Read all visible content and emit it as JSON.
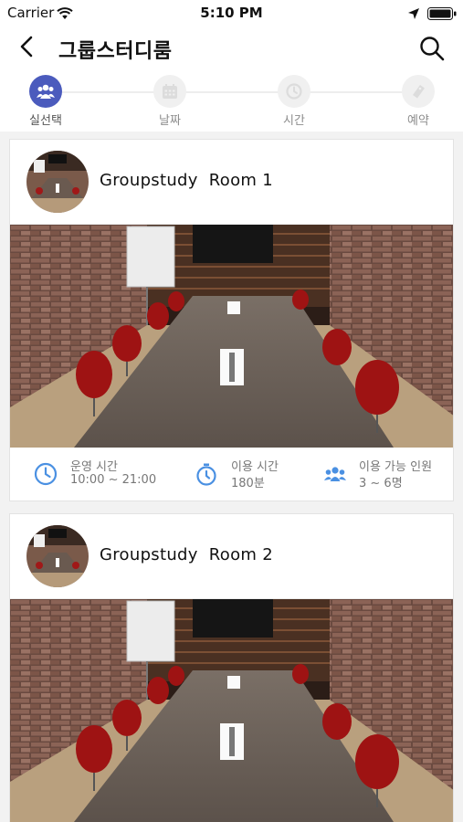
{
  "status_bar": {
    "carrier": "Carrier",
    "time": "5:10 PM"
  },
  "header": {
    "title": "그룹스터디룸"
  },
  "stepper": {
    "steps": [
      {
        "label": "실선택",
        "icon": "group-icon",
        "active": true
      },
      {
        "label": "날짜",
        "icon": "calendar-icon",
        "active": false
      },
      {
        "label": "시간",
        "icon": "clock-icon",
        "active": false
      },
      {
        "label": "예약",
        "icon": "ticket-icon",
        "active": false
      }
    ]
  },
  "rooms": [
    {
      "name": "Groupstudy  Room 1",
      "info": [
        {
          "label": "운영 시간",
          "value": "10:00 ~ 21:00",
          "icon": "clock-icon"
        },
        {
          "label": "이용 시간",
          "value": "180분",
          "icon": "stopwatch-icon"
        },
        {
          "label": "이용 가능 인원",
          "value": "3 ~ 6명",
          "icon": "people-icon"
        }
      ]
    },
    {
      "name": "Groupstudy  Room 2",
      "info": []
    }
  ],
  "colors": {
    "accent": "#4b5bbd",
    "info_icon": "#4a90e2"
  }
}
